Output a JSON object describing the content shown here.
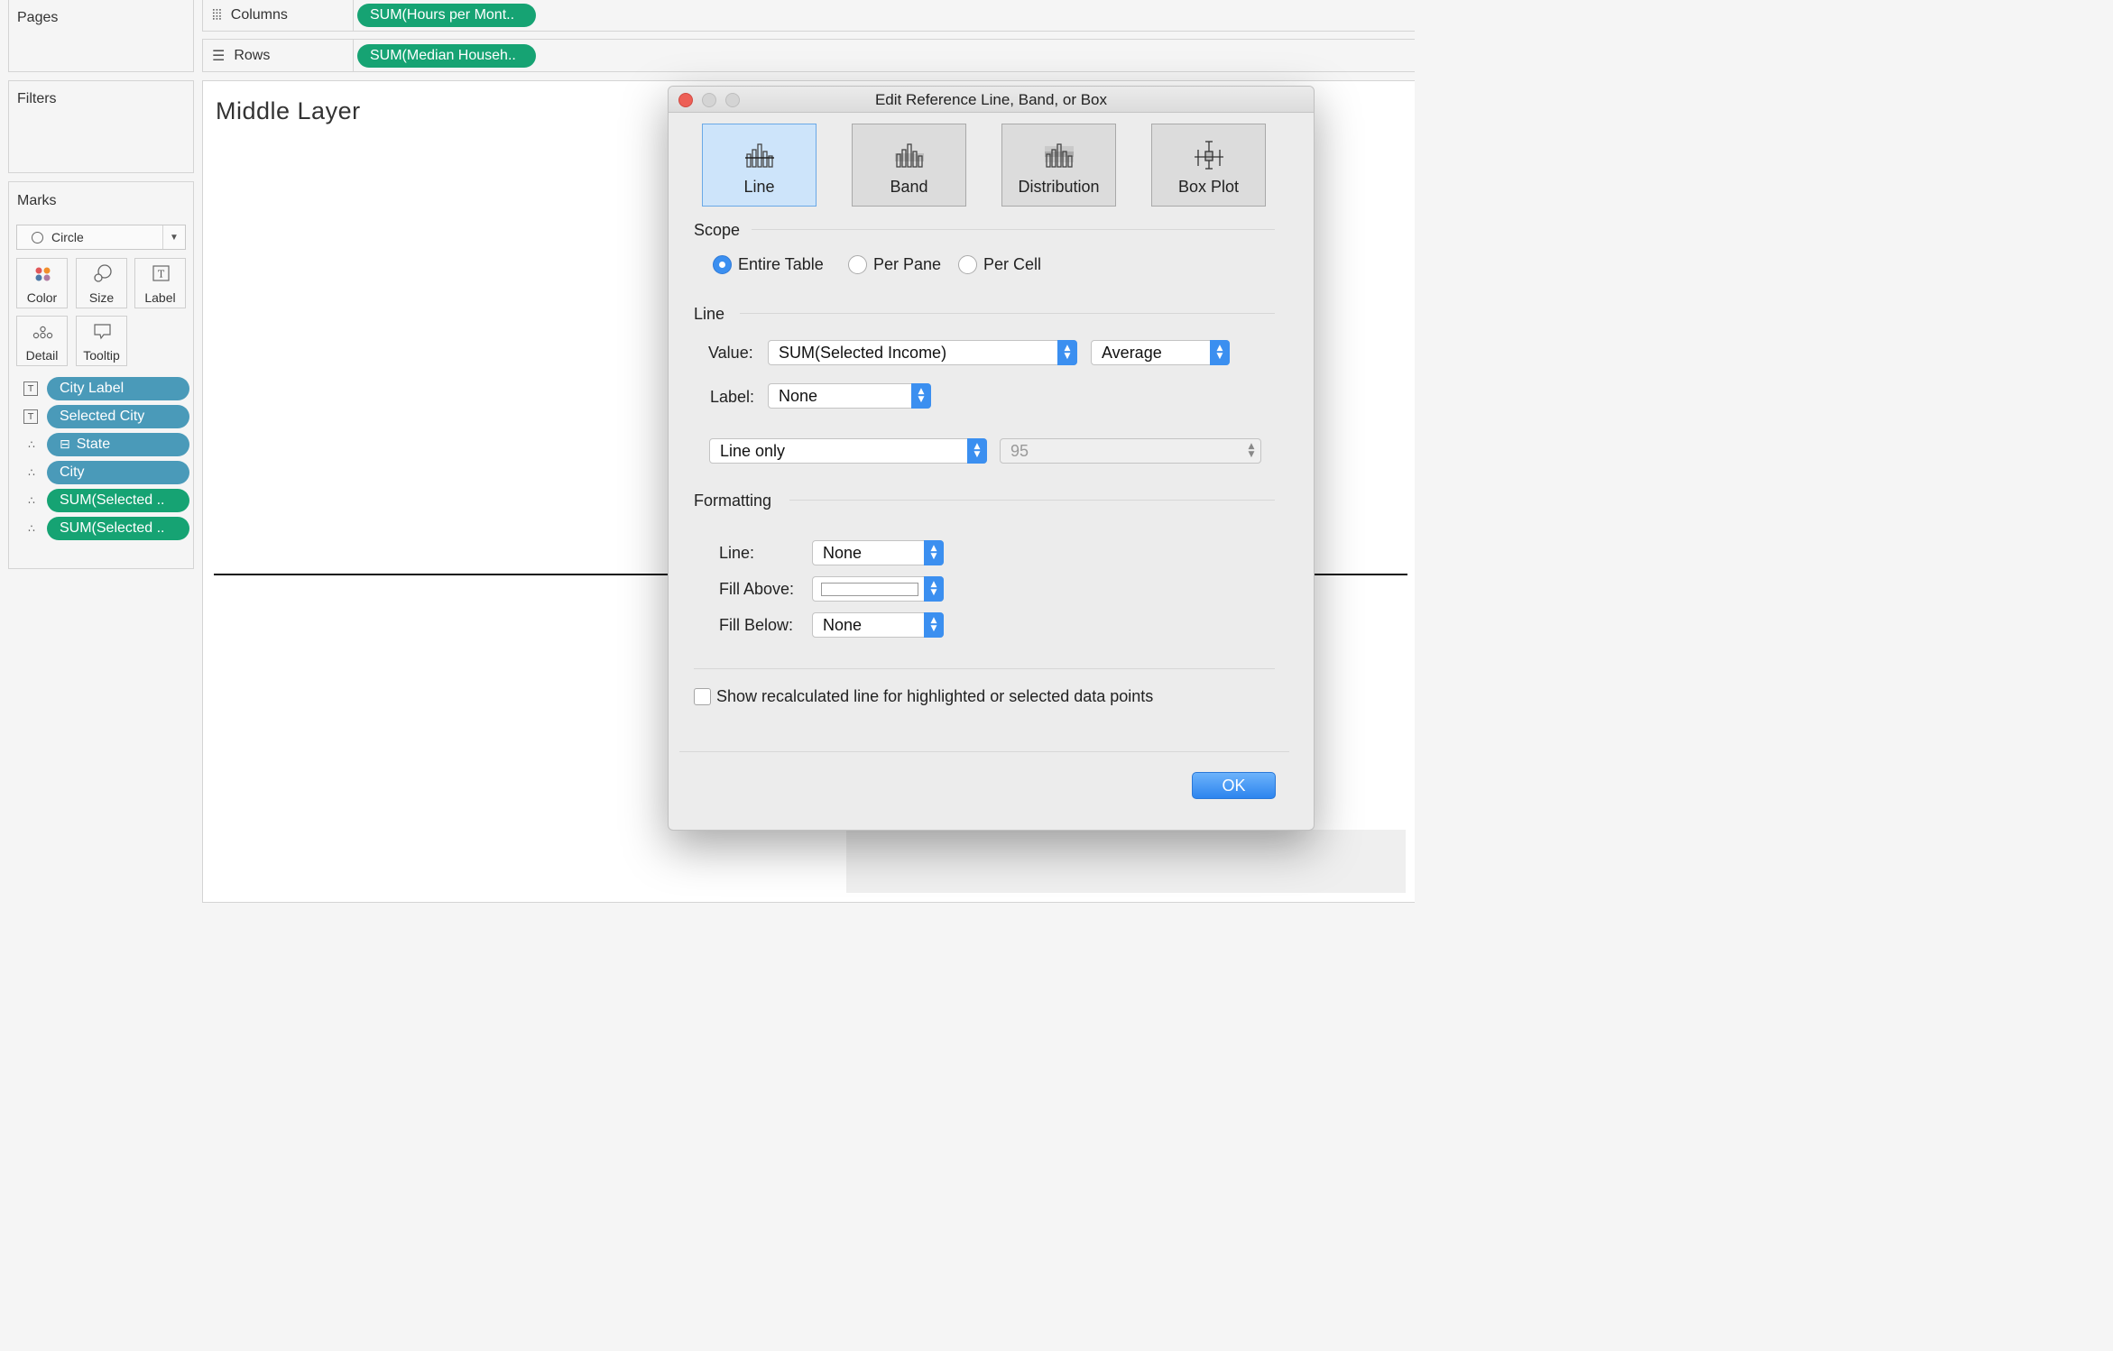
{
  "pages_pane": {
    "title": "Pages"
  },
  "filters_pane": {
    "title": "Filters"
  },
  "marks_pane": {
    "title": "Marks",
    "mark_type": "Circle",
    "cards": [
      "Color",
      "Size",
      "Label",
      "Detail",
      "Tooltip"
    ],
    "fields": [
      {
        "icon": "label-icon",
        "label": "City Label",
        "color": "#4a9ab9"
      },
      {
        "icon": "label-icon",
        "label": "Selected City",
        "color": "#4a9ab9"
      },
      {
        "icon": "detail-icon",
        "label": "State",
        "color": "#4a9ab9",
        "expand": "⊟"
      },
      {
        "icon": "detail-icon",
        "label": "City",
        "color": "#4a9ab9"
      },
      {
        "icon": "detail-icon",
        "label": "SUM(Selected ..",
        "color": "#16a373"
      },
      {
        "icon": "detail-icon",
        "label": "SUM(Selected ..",
        "color": "#16a373"
      }
    ]
  },
  "shelves": {
    "columns": {
      "label": "Columns",
      "pill": "SUM(Hours per Mont.."
    },
    "rows": {
      "label": "Rows",
      "pill": "SUM(Median Househ.."
    }
  },
  "view": {
    "title": "Middle Layer"
  },
  "dialog": {
    "title": "Edit Reference Line, Band, or Box",
    "types": [
      {
        "label": "Line",
        "selected": true
      },
      {
        "label": "Band",
        "selected": false
      },
      {
        "label": "Distribution",
        "selected": false
      },
      {
        "label": "Box Plot",
        "selected": false
      }
    ],
    "scope": {
      "heading": "Scope",
      "options": [
        "Entire Table",
        "Per Pane",
        "Per Cell"
      ],
      "selected": "Entire Table"
    },
    "line": {
      "heading": "Line",
      "value_label": "Value:",
      "value": "SUM(Selected Income)",
      "aggregation": "Average",
      "label_label": "Label:",
      "label_value": "None",
      "display": "Line only",
      "confidence": "95"
    },
    "formatting": {
      "heading": "Formatting",
      "line_label": "Line:",
      "line_value": "None",
      "fill_above_label": "Fill Above:",
      "fill_above_color": "#ffffff",
      "fill_below_label": "Fill Below:",
      "fill_below_value": "None"
    },
    "recalc_checkbox": {
      "label": "Show recalculated line for highlighted or selected data points",
      "checked": false
    },
    "ok_label": "OK"
  },
  "colors": {
    "accent": "#3b8ff0",
    "pill_green": "#16a373",
    "pill_blue": "#4a9ab9",
    "close": "#ed5f56"
  }
}
